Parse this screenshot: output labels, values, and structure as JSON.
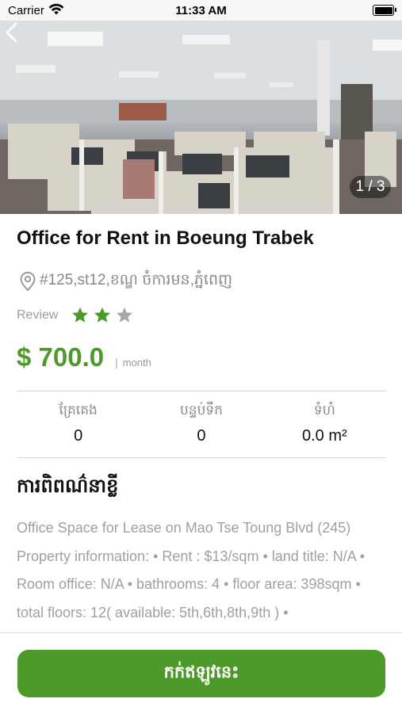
{
  "status_bar": {
    "carrier": "Carrier",
    "time": "11:33 AM"
  },
  "hero": {
    "page_indicator": "1 / 3"
  },
  "listing": {
    "title": "Office for Rent in Boeung Trabek",
    "address": "#125,st12,ខណ្ឌ ចំការមន,ភ្នំពេញ",
    "review": {
      "label": "Review",
      "rating": 2,
      "max": 3
    },
    "price": "$ 700.0",
    "price_separator": "|",
    "price_unit": "month"
  },
  "specs": [
    {
      "label": "គ្រែគេង",
      "value": "0"
    },
    {
      "label": "បន្ទប់ទឹក",
      "value": "0"
    },
    {
      "label": "ទំហំ",
      "value": "0.0 m²"
    }
  ],
  "description": {
    "title": "ការពិពណ៌នាខ្លី",
    "text": "Office Space for Lease on Mao Tse Toung Blvd (245) Property information: • Rent : $13/sqm • land title: N/A • Room office: N/A • bathrooms: 4 • floor area: 398sqm • total floors: 12( available: 5th,6th,8th,9th ) •"
  },
  "cta": {
    "label": "កក់ឥឡូវនេះ"
  },
  "colors": {
    "accent": "#4c9a2a",
    "star_filled": "#4c9a2a",
    "star_empty": "#a8a8a8"
  }
}
